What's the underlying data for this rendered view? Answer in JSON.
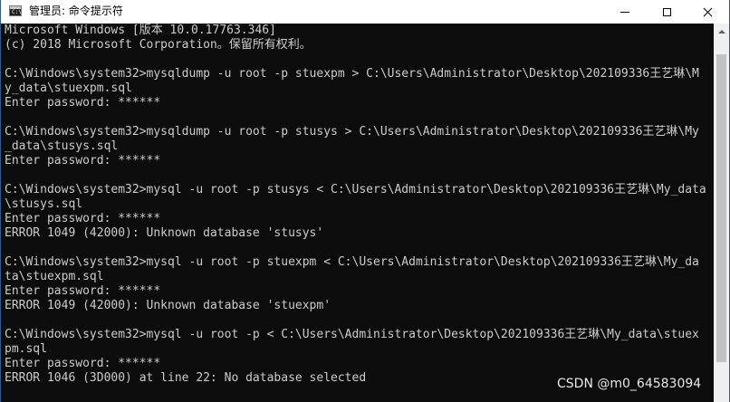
{
  "window": {
    "title": "管理员: 命令提示符",
    "icon": "cmd-icon",
    "controls": {
      "minimize_icon": "minimize-icon",
      "maximize_icon": "maximize-icon",
      "close_icon": "close-icon"
    }
  },
  "console": {
    "lines": [
      "Microsoft Windows [版本 10.0.17763.346]",
      "(c) 2018 Microsoft Corporation。保留所有权利。",
      "",
      "C:\\Windows\\system32>mysqldump -u root -p stuexpm > C:\\Users\\Administrator\\Desktop\\202109336王艺琳\\M",
      "y_data\\stuexpm.sql",
      "Enter password: ******",
      "",
      "C:\\Windows\\system32>mysqldump -u root -p stusys > C:\\Users\\Administrator\\Desktop\\202109336王艺琳\\My",
      "_data\\stusys.sql",
      "Enter password: ******",
      "",
      "C:\\Windows\\system32>mysql -u root -p stusys < C:\\Users\\Administrator\\Desktop\\202109336王艺琳\\My_data",
      "\\stusys.sql",
      "Enter password: ******",
      "ERROR 1049 (42000): Unknown database 'stusys'",
      "",
      "C:\\Windows\\system32>mysql -u root -p stuexpm < C:\\Users\\Administrator\\Desktop\\202109336王艺琳\\My_da",
      "ta\\stuexpm.sql",
      "Enter password: ******",
      "ERROR 1049 (42000): Unknown database 'stuexpm'",
      "",
      "C:\\Windows\\system32>mysql -u root -p < C:\\Users\\Administrator\\Desktop\\202109336王艺琳\\My_data\\stuex",
      "pm.sql",
      "Enter password: ******",
      "ERROR 1046 (3D000) at line 22: No database selected"
    ]
  },
  "watermark": "CSDN @m0_64583094",
  "colors": {
    "console_bg": "#0c0c0c",
    "console_text": "#cccccc",
    "titlebar_bg": "#ffffff"
  }
}
